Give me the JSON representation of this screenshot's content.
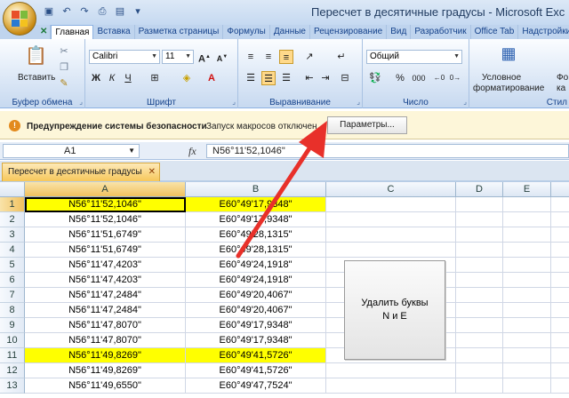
{
  "window": {
    "title": "Пересчет в десятичные градусы - Microsoft Exc"
  },
  "ribbon_tabs": [
    "Главная",
    "Вставка",
    "Разметка страницы",
    "Формулы",
    "Данные",
    "Рецензирование",
    "Вид",
    "Разработчик",
    "Office Tab",
    "Надстройки"
  ],
  "ribbon": {
    "paste_label": "Вставить",
    "clipboard_label": "Буфер обмена",
    "font_name": "Calibri",
    "font_size": "11",
    "font_group_label": "Шрифт",
    "bold": "Ж",
    "italic": "К",
    "underline": "Ч",
    "align_label": "Выравнивание",
    "number_format": "Общий",
    "number_label": "Число",
    "percent": "%",
    "thousands": "000",
    "cond_format_1": "Условное",
    "cond_format_2": "форматирование",
    "styles_label": "Стил",
    "format_partial_1": "Фо",
    "format_partial_2": "ка"
  },
  "security_bar": {
    "title": "Предупреждение системы безопасности",
    "message": "Запуск макросов отключен.",
    "button": "Параметры..."
  },
  "formula_bar": {
    "name_box": "A1",
    "fx": "fx",
    "formula": "N56°11'52,1046\""
  },
  "document_tab": {
    "label": "Пересчет в десятичные градусы",
    "close": "✕"
  },
  "columns": [
    "A",
    "B",
    "C",
    "D",
    "E"
  ],
  "rows": [
    {
      "n": "1",
      "a": "N56°11'52,1046\"",
      "b": "E60°49'17,9348\"",
      "highlight": true
    },
    {
      "n": "2",
      "a": "N56°11'52,1046\"",
      "b": "E60°49'17,9348\"",
      "highlight": false
    },
    {
      "n": "3",
      "a": "N56°11'51,6749\"",
      "b": "E60°49'28,1315\"",
      "highlight": false
    },
    {
      "n": "4",
      "a": "N56°11'51,6749\"",
      "b": "E60°49'28,1315\"",
      "highlight": false
    },
    {
      "n": "5",
      "a": "N56°11'47,4203\"",
      "b": "E60°49'24,1918\"",
      "highlight": false
    },
    {
      "n": "6",
      "a": "N56°11'47,4203\"",
      "b": "E60°49'24,1918\"",
      "highlight": false
    },
    {
      "n": "7",
      "a": "N56°11'47,2484\"",
      "b": "E60°49'20,4067\"",
      "highlight": false
    },
    {
      "n": "8",
      "a": "N56°11'47,2484\"",
      "b": "E60°49'20,4067\"",
      "highlight": false
    },
    {
      "n": "9",
      "a": "N56°11'47,8070\"",
      "b": "E60°49'17,9348\"",
      "highlight": false
    },
    {
      "n": "10",
      "a": "N56°11'47,8070\"",
      "b": "E60°49'17,9348\"",
      "highlight": false
    },
    {
      "n": "11",
      "a": "N56°11'49,8269\"",
      "b": "E60°49'41,5726\"",
      "highlight": true
    },
    {
      "n": "12",
      "a": "N56°11'49,8269\"",
      "b": "E60°49'41,5726\"",
      "highlight": false
    },
    {
      "n": "13",
      "a": "N56°11'49,6550\"",
      "b": "E60°49'47,7524\"",
      "highlight": false
    }
  ],
  "macro_button": {
    "line1": "Удалить буквы",
    "line2": "N и E"
  },
  "colors": {
    "highlight": "#ffff00",
    "arrow": "#e8302a"
  }
}
